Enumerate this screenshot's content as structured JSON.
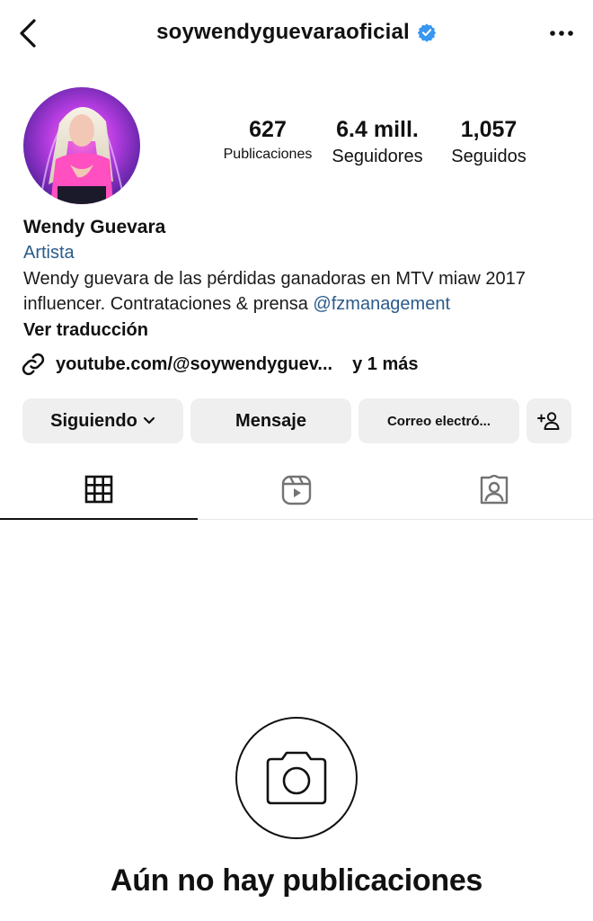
{
  "header": {
    "username": "soywendyguevaraoficial",
    "icons": {
      "back": "chevron-left-icon",
      "verified": "verified-badge-icon",
      "more": "more-horizontal-icon"
    },
    "verified_color": "#3897f0"
  },
  "stats": {
    "posts": {
      "value": "627",
      "label": "Publicaciones"
    },
    "followers": {
      "value": "6.4 mill.",
      "label": "Seguidores"
    },
    "following": {
      "value": "1,057",
      "label": "Seguidos"
    }
  },
  "bio": {
    "name": "Wendy Guevara",
    "category": "Artista",
    "text": "Wendy guevara  de las pérdidas ganadoras en MTV miaw 2017 influencer. Contrataciones & prensa ",
    "mention": "@fzmanagement",
    "translate": "Ver traducción"
  },
  "link": {
    "url": "youtube.com/@soywendyguev...",
    "more": "y 1 más",
    "icon": "link-icon"
  },
  "actions": {
    "follow": "Siguiendo",
    "message": "Mensaje",
    "email": "Correo electró...",
    "add_user_icon": "add-person-icon"
  },
  "tabs": [
    {
      "name": "grid-icon",
      "active": true
    },
    {
      "name": "reels-icon",
      "active": false
    },
    {
      "name": "tagged-icon",
      "active": false
    }
  ],
  "empty": {
    "icon": "camera-icon",
    "title": "Aún no hay publicaciones"
  },
  "colors": {
    "link_blue": "#2a5b8a",
    "button_bg": "#efefef"
  }
}
